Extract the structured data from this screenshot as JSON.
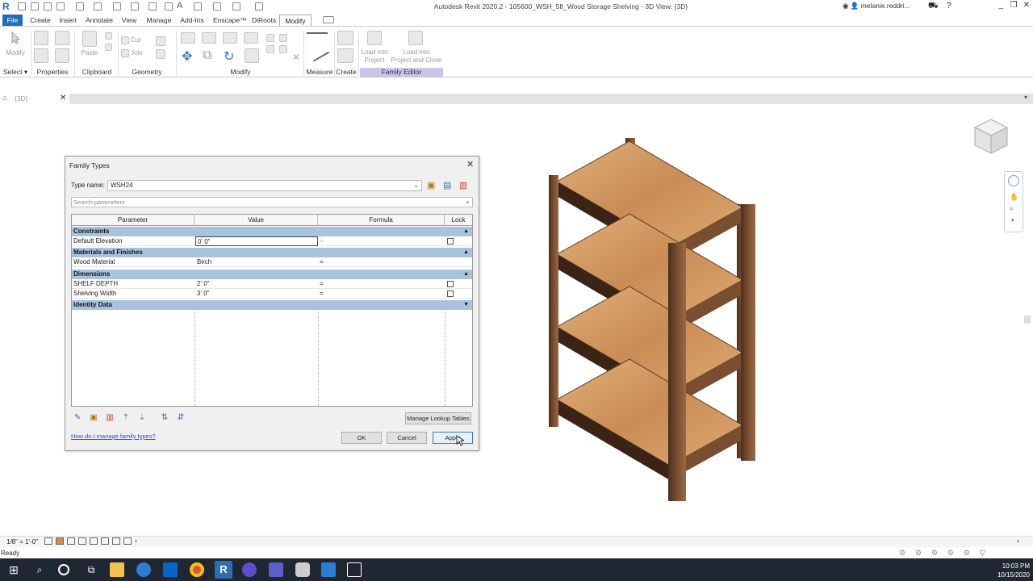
{
  "window": {
    "title": "Autodesk Revit 2020.2 - 105600_WSH_5ft_Wood Storage Shelving - 3D View: {3D}",
    "user": "melanie.reddri...",
    "controls": [
      "_",
      "❐",
      "✕"
    ]
  },
  "tabs": [
    "File",
    "Create",
    "Insert",
    "Annotate",
    "View",
    "Manage",
    "Add-Ins",
    "Enscape™",
    "DiRoots",
    "Modify"
  ],
  "ribbon": {
    "panels": [
      "Select ▾",
      "Properties",
      "Clipboard",
      "Geometry",
      "Modify",
      "Measure",
      "Create",
      "Family Editor"
    ],
    "modify_label": "Modify",
    "paste_label": "Paste",
    "cut_label": "Cut",
    "join_label": "Join",
    "load_project_label": "Load into\nProject",
    "load_close_label": "Load into\nProject and Close"
  },
  "view_tab": {
    "label": "{3D}",
    "close": "✕"
  },
  "dialog": {
    "title": "Family Types",
    "type_name_label": "Type name:",
    "type_name_value": "WSH24",
    "search_placeholder": "Search parameters",
    "headers": [
      "Parameter",
      "Value",
      "Formula",
      "Lock"
    ],
    "groups": [
      {
        "name": "Constraints",
        "rows": [
          {
            "param": "Default Elevation",
            "value": "0'  0\"",
            "formula": "=",
            "lock": true
          }
        ]
      },
      {
        "name": "Materials and Finishes",
        "rows": [
          {
            "param": "Wood Material",
            "value": "Birch",
            "formula": "=",
            "lock": false
          }
        ]
      },
      {
        "name": "Dimensions",
        "rows": [
          {
            "param": "SHELF DEPTH",
            "value": "2'  0\"",
            "formula": "=",
            "lock": true
          },
          {
            "name_override": "",
            "param": "Shelving Width",
            "value": "3'  0\"",
            "formula": "=",
            "lock": true
          }
        ]
      },
      {
        "name": "Identity Data",
        "rows": []
      }
    ],
    "lookup_button": "Manage Lookup Tables",
    "help_link": "How do I manage family types?",
    "ok": "OK",
    "cancel": "Cancel",
    "apply": "Apply"
  },
  "status": {
    "scale": "1/8\" = 1'-0\"",
    "ready": "Ready"
  },
  "clock": {
    "time": "10:03 PM",
    "date": "10/15/2020"
  },
  "colors": {
    "accent": "#1e6fb8",
    "group_header": "#a9c3df",
    "family_editor": "#c9c6ea",
    "taskbar": "#1f2733"
  }
}
